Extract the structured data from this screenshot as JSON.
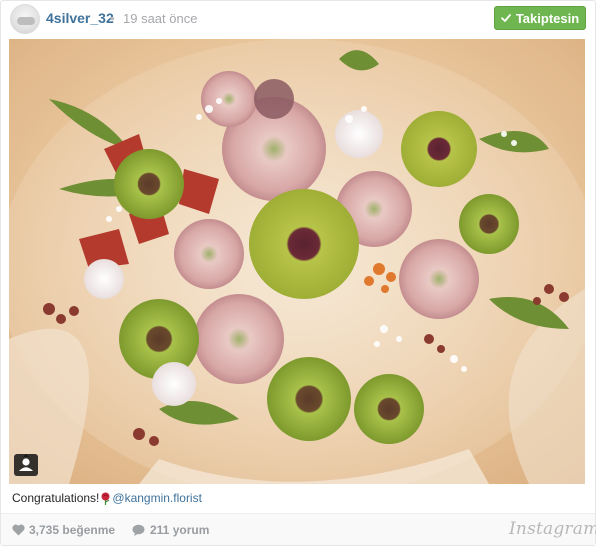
{
  "post": {
    "username": "4silver_32",
    "separator": "•",
    "timestamp": "19 saat önce",
    "follow_label": "Takiptesin",
    "caption": {
      "text": "Congratulations!",
      "mention": "@kangmin.florist"
    },
    "likes": "3,735 beğenme",
    "comments": "211 yorum",
    "brand": "Instagram"
  },
  "colors": {
    "follow_green": "#70b650",
    "username_blue": "#3f729b",
    "muted_gray": "#999da1"
  },
  "icons": {
    "follow": "check-icon",
    "tagged": "person-icon",
    "likes": "heart-icon",
    "comments": "comment-bubble-icon",
    "caption_emoji": "rose-icon"
  }
}
